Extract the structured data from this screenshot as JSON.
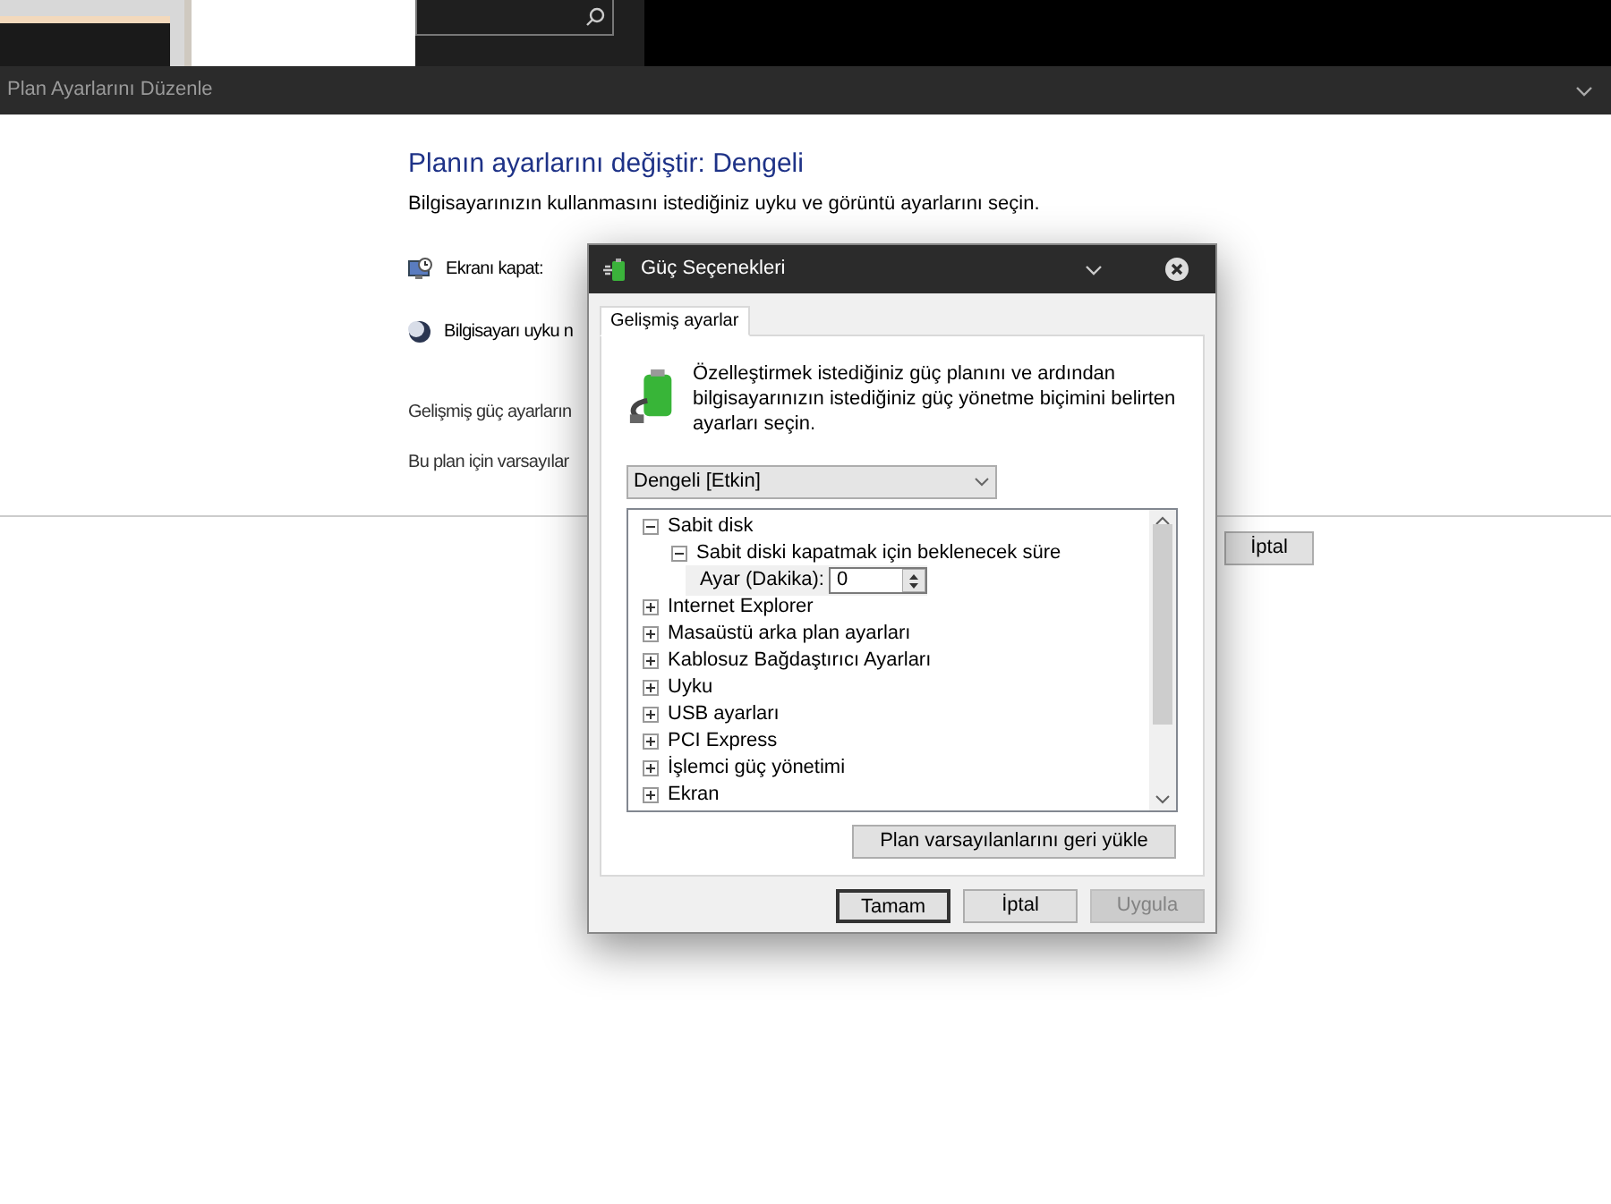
{
  "background_window": {
    "title": "Plan Ayarlarını Düzenle",
    "heading": "Planın ayarlarını değiştir: Dengeli",
    "description": "Bilgisayarınızın kullanmasını istediğiniz uyku ve görüntü ayarlarını seçin.",
    "settings": [
      {
        "kind": "display",
        "label": "Ekranı kapat:"
      },
      {
        "kind": "sleep",
        "label": "Bilgisayarı uyku n"
      }
    ],
    "links": [
      "Gelişmiş güç ayarların",
      "Bu plan için varsayılar"
    ],
    "buttons": [
      "İptal"
    ]
  },
  "dialog": {
    "title": "Güç Seçenekleri",
    "tabs": [
      {
        "label": "Gelişmiş ayarlar",
        "selected": true
      }
    ],
    "description": "Özelleştirmek istediğiniz güç planını ve ardından bilgisayarınızın istediğiniz güç yönetme biçimini belirten ayarları seçin.",
    "plan_dropdown": {
      "value": "Dengeli [Etkin]"
    },
    "tree": [
      {
        "label": "Sabit disk",
        "expanded": true,
        "children": [
          {
            "label": "Sabit diski kapatmak için beklenecek süre",
            "expanded": true,
            "children": [
              {
                "kind": "setting",
                "label": "Ayar (Dakika):",
                "value": "0"
              }
            ]
          }
        ]
      },
      {
        "label": "Internet Explorer",
        "expanded": false
      },
      {
        "label": "Masaüstü arka plan ayarları",
        "expanded": false
      },
      {
        "label": "Kablosuz Bağdaştırıcı Ayarları",
        "expanded": false
      },
      {
        "label": "Uyku",
        "expanded": false
      },
      {
        "label": "USB ayarları",
        "expanded": false
      },
      {
        "label": "PCI Express",
        "expanded": false
      },
      {
        "label": "İşlemci güç yönetimi",
        "expanded": false
      },
      {
        "label": "Ekran",
        "expanded": false
      }
    ],
    "restore_button": "Plan varsayılanlarını geri yükle",
    "buttons": [
      {
        "label": "Tamam",
        "disabled": false
      },
      {
        "label": "İptal",
        "disabled": false
      },
      {
        "label": "Uygula",
        "disabled": true
      }
    ]
  }
}
